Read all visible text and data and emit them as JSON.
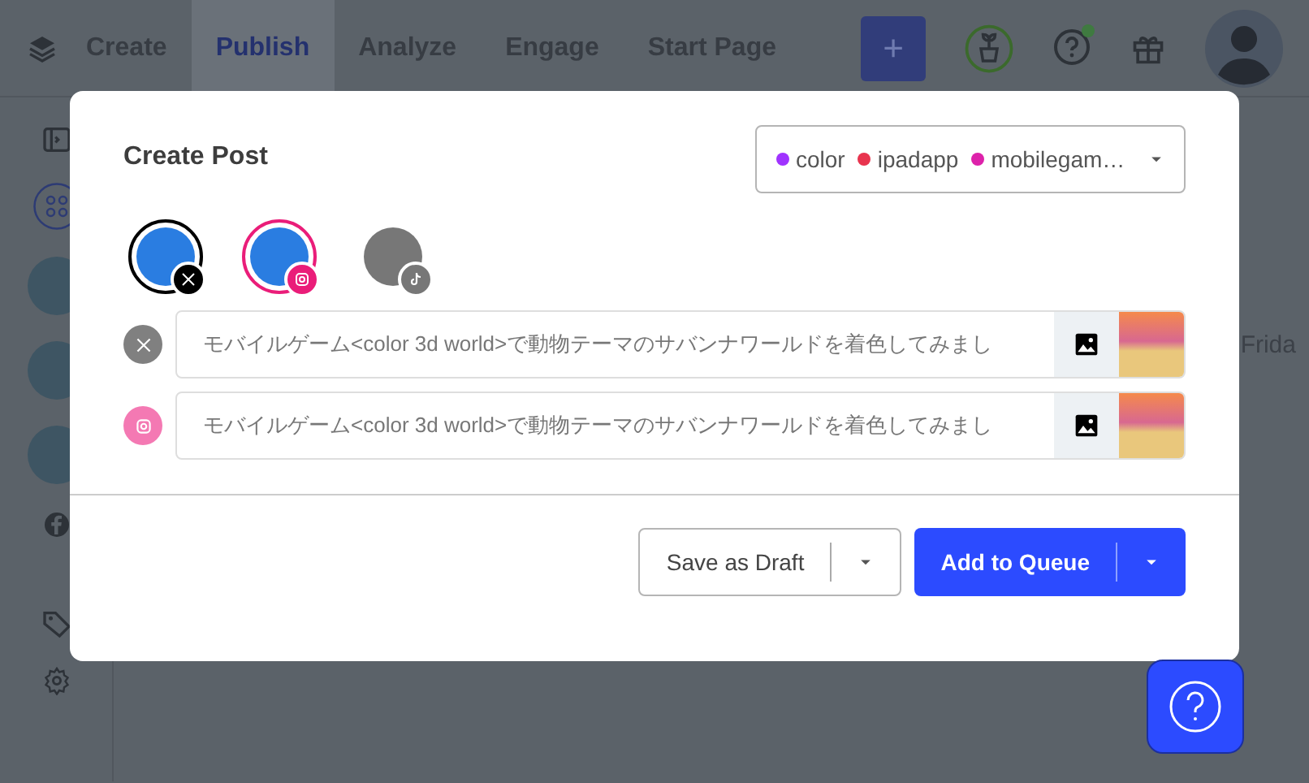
{
  "nav": {
    "items": [
      {
        "label": "Create",
        "selected": false
      },
      {
        "label": "Publish",
        "selected": true
      },
      {
        "label": "Analyze",
        "selected": false
      },
      {
        "label": "Engage",
        "selected": false
      },
      {
        "label": "Start Page",
        "selected": false
      }
    ],
    "new_button": "+"
  },
  "calendar": {
    "day_label": "Frida"
  },
  "modal": {
    "title": "Create Post",
    "tags": [
      {
        "label": "color",
        "color": "#a033ff"
      },
      {
        "label": "ipadapp",
        "color": "#e8344e"
      },
      {
        "label": "mobilegam…",
        "color": "#dd22aa"
      }
    ],
    "accounts": [
      {
        "kind": "x",
        "selected": true
      },
      {
        "kind": "instagram",
        "selected": true
      },
      {
        "kind": "tiktok",
        "selected": false
      }
    ],
    "posts": [
      {
        "kind": "x",
        "text": "モバイルゲーム<color 3d world>で動物テーマのサバンナワールドを着色してみまし"
      },
      {
        "kind": "instagram",
        "text": "モバイルゲーム<color 3d world>で動物テーマのサバンナワールドを着色してみまし"
      }
    ],
    "draft_button": "Save as Draft",
    "queue_button": "Add to Queue"
  }
}
